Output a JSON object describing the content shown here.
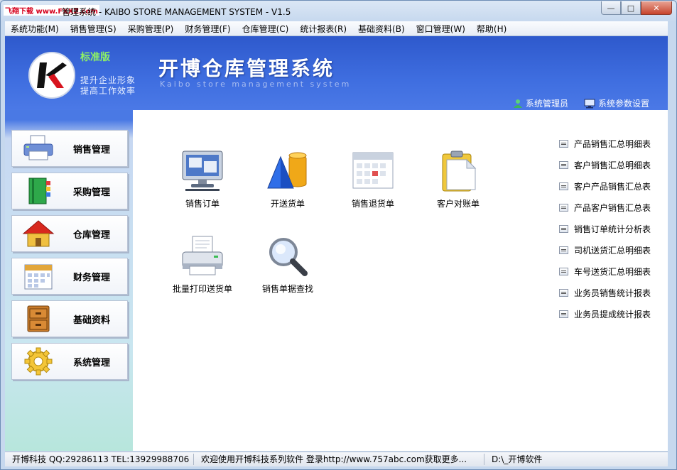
{
  "window": {
    "title": "管理系统 - KAIBO STORE MANAGEMENT SYSTEM - V1.5",
    "watermark": "飞翔下载 www.FXXZ.com",
    "controls": {
      "minimize": "—",
      "maximize": "□",
      "close": "✕"
    }
  },
  "menu": [
    "系统功能(M)",
    "销售管理(S)",
    "采购管理(P)",
    "财务管理(F)",
    "仓库管理(C)",
    "统计报表(R)",
    "基础资料(B)",
    "窗口管理(W)",
    "帮助(H)"
  ],
  "banner": {
    "logo_letter": "K",
    "edition": "标准版",
    "slogan_line1": "提升企业形象",
    "slogan_line2": "提高工作效率",
    "title": "开博仓库管理系统",
    "subtitle": "Kaibo store management system",
    "user_link": "系统管理员",
    "settings_link": "系统参数设置"
  },
  "sidebar": [
    {
      "label": "销售管理",
      "icon": "printer-icon"
    },
    {
      "label": "采购管理",
      "icon": "book-icon"
    },
    {
      "label": "仓库管理",
      "icon": "house-icon"
    },
    {
      "label": "财务管理",
      "icon": "calendar-icon"
    },
    {
      "label": "基础资料",
      "icon": "cabinet-icon"
    },
    {
      "label": "系统管理",
      "icon": "gear-icon"
    }
  ],
  "functions": [
    {
      "label": "销售订单",
      "icon": "monitor-icon"
    },
    {
      "label": "开送货单",
      "icon": "shapes-icon"
    },
    {
      "label": "销售退货单",
      "icon": "calendar-icon"
    },
    {
      "label": "客户对账单",
      "icon": "clipboard-icon"
    },
    {
      "label": "批量打印送货单",
      "icon": "printer-icon"
    },
    {
      "label": "销售单据查找",
      "icon": "magnifier-icon"
    }
  ],
  "reports": [
    "产品销售汇总明细表",
    "客户销售汇总明细表",
    "客户产品销售汇总表",
    "产品客户销售汇总表",
    "销售订单统计分析表",
    "司机送货汇总明细表",
    "车号送货汇总明细表",
    "业务员销售统计报表",
    "业务员提成统计报表"
  ],
  "status": {
    "company": "开博科技 QQ:29286113 TEL:13929988706",
    "welcome": "欢迎使用开博科技系列软件   登录http://www.757abc.com获取更多...",
    "path": "D:\\_开博软件"
  }
}
